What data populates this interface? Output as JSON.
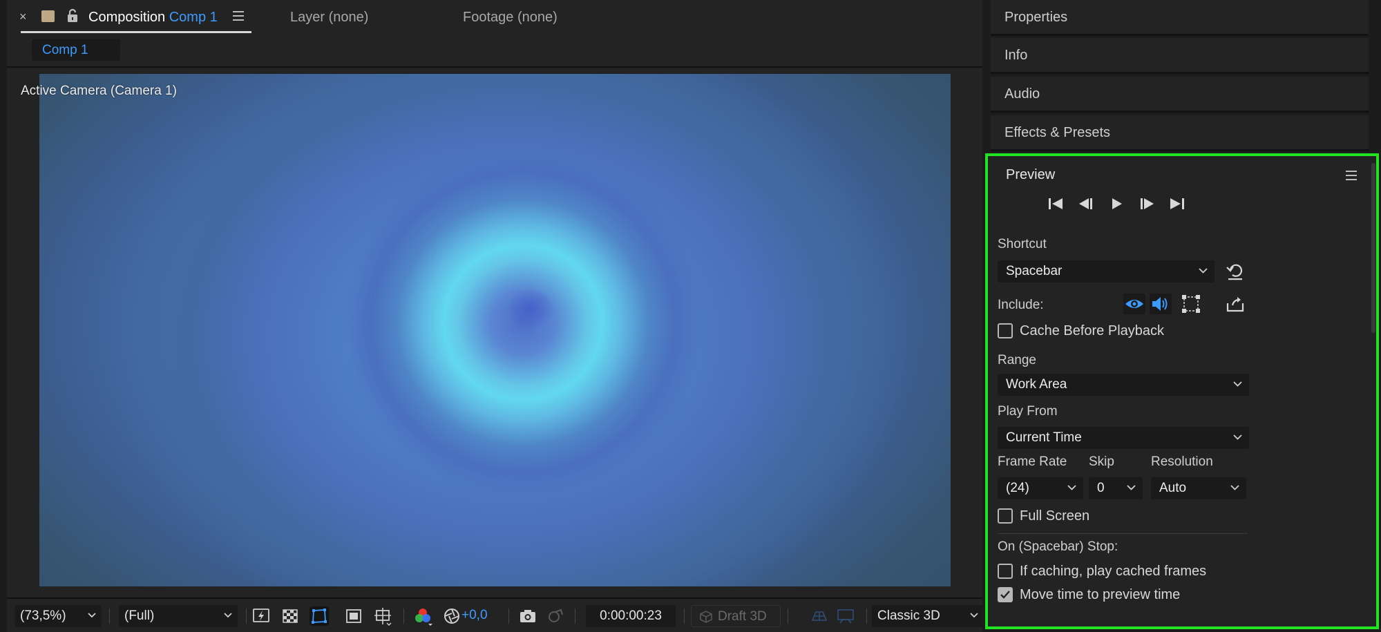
{
  "comp_panel": {
    "tab_close": "×",
    "tab_title_prefix": "Composition",
    "tab_title_comp": "Comp 1",
    "tab_layer": "Layer (none)",
    "tab_footage": "Footage (none)",
    "comp_chip": "Comp 1",
    "viewer_label": "Active Camera (Camera 1)"
  },
  "bottombar": {
    "zoom": "(73,5%)",
    "resolution": "(Full)",
    "exposure": "+0,0",
    "timecode": "0:00:00:23",
    "draft3d": "Draft 3D",
    "renderer": "Classic 3D"
  },
  "side_panels": [
    {
      "label": "Properties"
    },
    {
      "label": "Info"
    },
    {
      "label": "Audio"
    },
    {
      "label": "Effects & Presets"
    }
  ],
  "preview": {
    "title": "Preview",
    "shortcut_label": "Shortcut",
    "shortcut_value": "Spacebar",
    "include_label": "Include:",
    "cache_before_playback": "Cache Before Playback",
    "range_label": "Range",
    "range_value": "Work Area",
    "play_from_label": "Play From",
    "play_from_value": "Current Time",
    "frame_rate_label": "Frame Rate",
    "frame_rate_value": "(24)",
    "skip_label": "Skip",
    "skip_value": "0",
    "resolution_label": "Resolution",
    "resolution_value": "Auto",
    "full_screen": "Full Screen",
    "on_stop_label": "On (Spacebar) Stop:",
    "if_caching": "If caching, play cached frames",
    "move_time": "Move time to preview time"
  },
  "colors": {
    "accent_blue": "#3d9bff",
    "highlight_green": "#22e422",
    "panel_bg": "#232323"
  }
}
